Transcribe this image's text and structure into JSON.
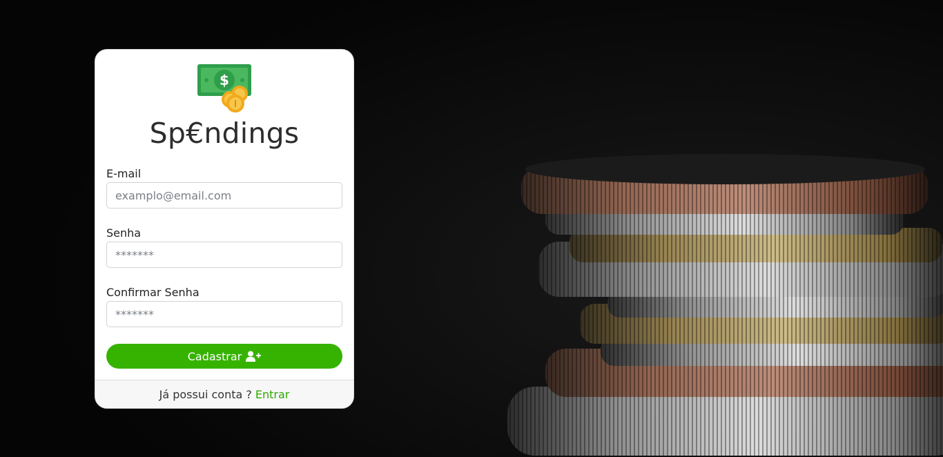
{
  "brand": {
    "name": "Sp€ndings"
  },
  "form": {
    "email": {
      "label": "E-mail",
      "placeholder": "examplo@email.com",
      "value": ""
    },
    "password": {
      "label": "Senha",
      "placeholder": "*******",
      "value": ""
    },
    "confirm_password": {
      "label": "Confirmar Senha",
      "placeholder": "*******",
      "value": ""
    },
    "submit_label": "Cadastrar",
    "submit_icon": "user-plus-icon"
  },
  "footer": {
    "question": "Já possui conta ?",
    "link_label": "Entrar"
  },
  "colors": {
    "accent": "#36b300",
    "link": "#2eaa00",
    "background": "#0d0d0d"
  },
  "background_image": "coin-stack"
}
